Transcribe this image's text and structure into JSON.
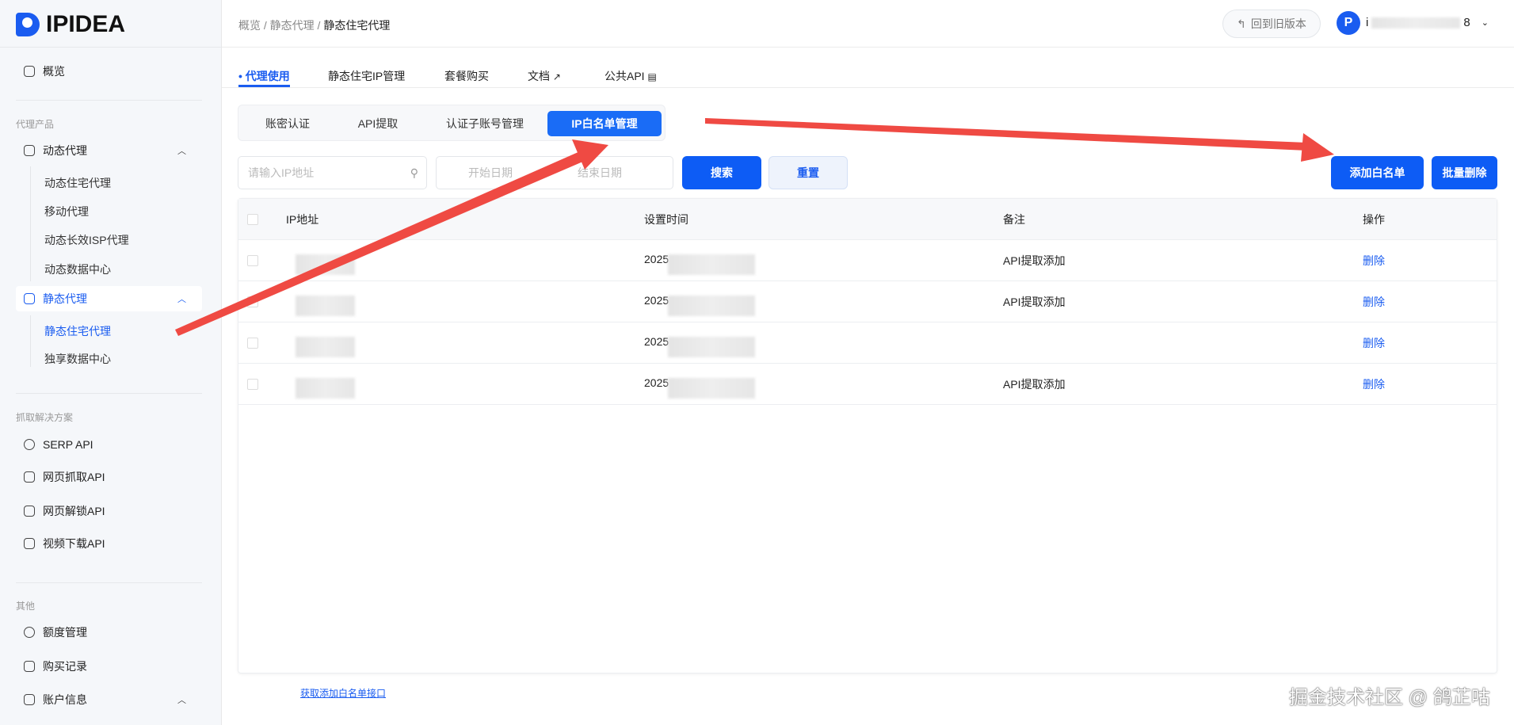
{
  "brand": {
    "name": "IPIDEA"
  },
  "sidebar": {
    "overview": "概览",
    "section_proxy": "代理产品",
    "dynamic": {
      "label": "动态代理",
      "items": [
        "动态住宅代理",
        "移动代理",
        "动态长效ISP代理",
        "动态数据中心"
      ]
    },
    "static": {
      "label": "静态代理",
      "items": [
        "静态住宅代理",
        "独享数据中心"
      ]
    },
    "section_scrape": "抓取解决方案",
    "scrape_items": [
      "SERP API",
      "网页抓取API",
      "网页解锁API",
      "视频下载API"
    ],
    "section_other": "其他",
    "other_items": [
      "额度管理",
      "购买记录",
      "账户信息"
    ]
  },
  "header": {
    "breadcrumb": [
      "概览",
      "静态代理",
      "静态住宅代理"
    ],
    "old_version": "回到旧版本",
    "username_start": "i",
    "username_end": "8"
  },
  "tabs": [
    "代理使用",
    "静态住宅IP管理",
    "套餐购买",
    "文档",
    "公共API"
  ],
  "segments": [
    "账密认证",
    "API提取",
    "认证子账号管理",
    "IP白名单管理"
  ],
  "filters": {
    "ip_placeholder": "请输入IP地址",
    "start_placeholder": "开始日期",
    "end_placeholder": "结束日期",
    "search": "搜索",
    "reset": "重置",
    "add": "添加白名单",
    "batch_delete": "批量删除"
  },
  "table": {
    "columns": [
      "IP地址",
      "设置时间",
      "备注",
      "操作"
    ],
    "rows": [
      {
        "time": "2025",
        "note": "API提取添加",
        "action": "删除"
      },
      {
        "time": "2025",
        "note": "API提取添加",
        "action": "删除"
      },
      {
        "time": "2025",
        "note": "",
        "action": "删除"
      },
      {
        "time": "2025",
        "note": "API提取添加",
        "action": "删除"
      }
    ]
  },
  "footer_link": "获取添加白名单接口",
  "watermark": "掘金技术社区 @ 鸽芷咕",
  "colors": {
    "accent": "#1a5cf0",
    "annotation": "#ef4a43"
  }
}
